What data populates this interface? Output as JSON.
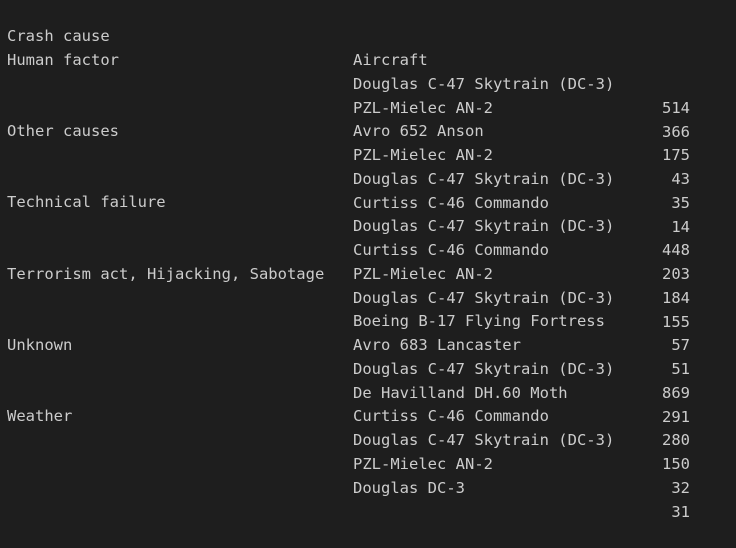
{
  "header": {
    "cause_label": "Crash cause",
    "aircraft_label": "Aircraft"
  },
  "rows": [
    {
      "cause": "Human factor",
      "aircraft": "Douglas C-47 Skytrain (DC-3)",
      "count": "514"
    },
    {
      "cause": "",
      "aircraft": "PZL-Mielec AN-2",
      "count": "366"
    },
    {
      "cause": "",
      "aircraft": "Avro 652 Anson",
      "count": "175"
    },
    {
      "cause": "Other causes",
      "aircraft": "PZL-Mielec AN-2",
      "count": "43"
    },
    {
      "cause": "",
      "aircraft": "Douglas C-47 Skytrain (DC-3)",
      "count": "35"
    },
    {
      "cause": "",
      "aircraft": "Curtiss C-46 Commando",
      "count": "14"
    },
    {
      "cause": "Technical failure",
      "aircraft": "Douglas C-47 Skytrain (DC-3)",
      "count": "448"
    },
    {
      "cause": "",
      "aircraft": "Curtiss C-46 Commando",
      "count": "203"
    },
    {
      "cause": "",
      "aircraft": "PZL-Mielec AN-2",
      "count": "184"
    },
    {
      "cause": "Terrorism act, Hijacking, Sabotage",
      "aircraft": "Douglas C-47 Skytrain (DC-3)",
      "count": "155"
    },
    {
      "cause": "",
      "aircraft": "Boeing B-17 Flying Fortress",
      "count": "57"
    },
    {
      "cause": "",
      "aircraft": "Avro 683 Lancaster",
      "count": "51"
    },
    {
      "cause": "Unknown",
      "aircraft": "Douglas C-47 Skytrain (DC-3)",
      "count": "869"
    },
    {
      "cause": "",
      "aircraft": "De Havilland DH.60 Moth",
      "count": "291"
    },
    {
      "cause": "",
      "aircraft": "Curtiss C-46 Commando",
      "count": "280"
    },
    {
      "cause": "Weather",
      "aircraft": "Douglas C-47 Skytrain (DC-3)",
      "count": "150"
    },
    {
      "cause": "",
      "aircraft": "PZL-Mielec AN-2",
      "count": "32"
    },
    {
      "cause": "",
      "aircraft": "Douglas DC-3",
      "count": "31"
    }
  ]
}
